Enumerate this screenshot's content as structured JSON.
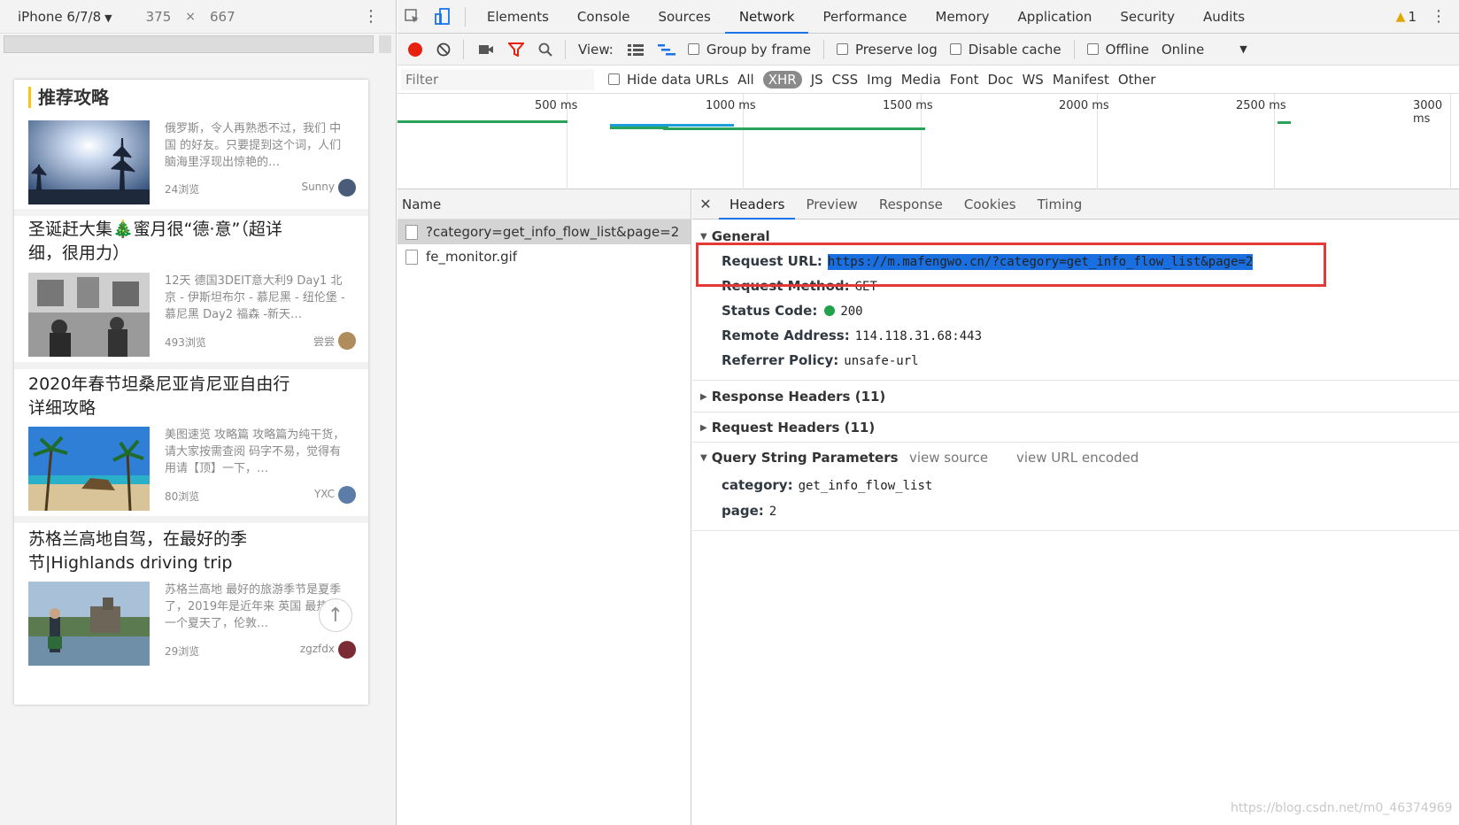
{
  "device_toolbar": {
    "device": "iPhone 6/7/8",
    "width": "375",
    "times": "×",
    "height": "667"
  },
  "mobile_page": {
    "section_title": "推荐攻略",
    "cards": [
      {
        "title": "",
        "desc": "俄罗斯，令人再熟悉不过，我们 中国 的好友。只要提到这个词，人们脑海里浮现出惊艳的…",
        "views": "24浏览",
        "author": "Sunny"
      },
      {
        "title": "圣诞赶大集🎄蜜月很“德·意”（超详细，很用力）",
        "desc": "12天 德国3DEIT意大利9 Day1 北京 - 伊斯坦布尔 - 慕尼黑 - 纽伦堡 - 慕尼黑 Day2 福森 -新天…",
        "views": "493浏览",
        "author": "尝尝"
      },
      {
        "title": "2020年春节坦桑尼亚肯尼亚自由行详细攻略",
        "desc": "美图速览 攻略篇 攻略篇为纯干货，请大家按需查阅 码字不易，觉得有用请【顶】一下，…",
        "views": "80浏览",
        "author": "YXC"
      },
      {
        "title": "苏格兰高地自驾，在最好的季节|Highlands driving trip",
        "desc": "苏格兰高地 最好的旅游季节是夏季了，2019年是近年来 英国 最热的一个夏天了，伦敦…",
        "views": "29浏览",
        "author": "zgzfdx"
      }
    ]
  },
  "devtools": {
    "tabs": [
      "Elements",
      "Console",
      "Sources",
      "Network",
      "Performance",
      "Memory",
      "Application",
      "Security",
      "Audits"
    ],
    "active_tab": "Network",
    "warning_count": "1",
    "controls": {
      "view_label": "View:",
      "group_by_frame": "Group by frame",
      "preserve_log": "Preserve log",
      "disable_cache": "Disable cache",
      "offline": "Offline",
      "online": "Online"
    },
    "filter": {
      "placeholder": "Filter",
      "hide_data_urls": "Hide data URLs",
      "types": [
        "All",
        "XHR",
        "JS",
        "CSS",
        "Img",
        "Media",
        "Font",
        "Doc",
        "WS",
        "Manifest",
        "Other"
      ],
      "active_type": "XHR"
    },
    "timeline_ticks": [
      "500 ms",
      "1000 ms",
      "1500 ms",
      "2000 ms",
      "2500 ms",
      "3000 ms"
    ],
    "name_column": "Name",
    "requests": [
      "?category=get_info_flow_list&page=2",
      "fe_monitor.gif"
    ],
    "detail_tabs": [
      "Headers",
      "Preview",
      "Response",
      "Cookies",
      "Timing"
    ],
    "general": {
      "title": "General",
      "request_url_label": "Request URL:",
      "request_url": "https://m.mafengwo.cn/?category=get_info_flow_list&page=2",
      "request_method_label": "Request Method:",
      "request_method": "GET",
      "status_code_label": "Status Code:",
      "status_code": "200",
      "remote_address_label": "Remote Address:",
      "remote_address": "114.118.31.68:443",
      "referrer_policy_label": "Referrer Policy:",
      "referrer_policy": "unsafe-url"
    },
    "response_headers": "Response Headers (11)",
    "request_headers": "Request Headers (11)",
    "query_string": {
      "title": "Query String Parameters",
      "view_source": "view source",
      "view_url_encoded": "view URL encoded",
      "params": [
        {
          "key": "category:",
          "value": "get_info_flow_list"
        },
        {
          "key": "page:",
          "value": "2"
        }
      ]
    }
  },
  "watermark": "https://blog.csdn.net/m0_46374969"
}
